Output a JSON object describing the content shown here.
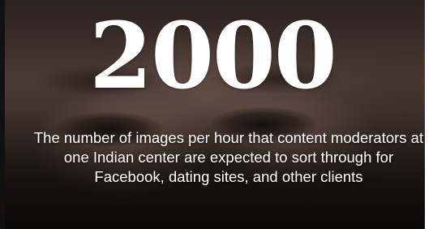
{
  "stat": {
    "number": "2000",
    "caption": "The number of images per hour that content moderators at one Indian center are expected to sort through for Facebook, dating sites, and other clients"
  },
  "background": {
    "description": "",
    "accent": "#ffffff"
  }
}
